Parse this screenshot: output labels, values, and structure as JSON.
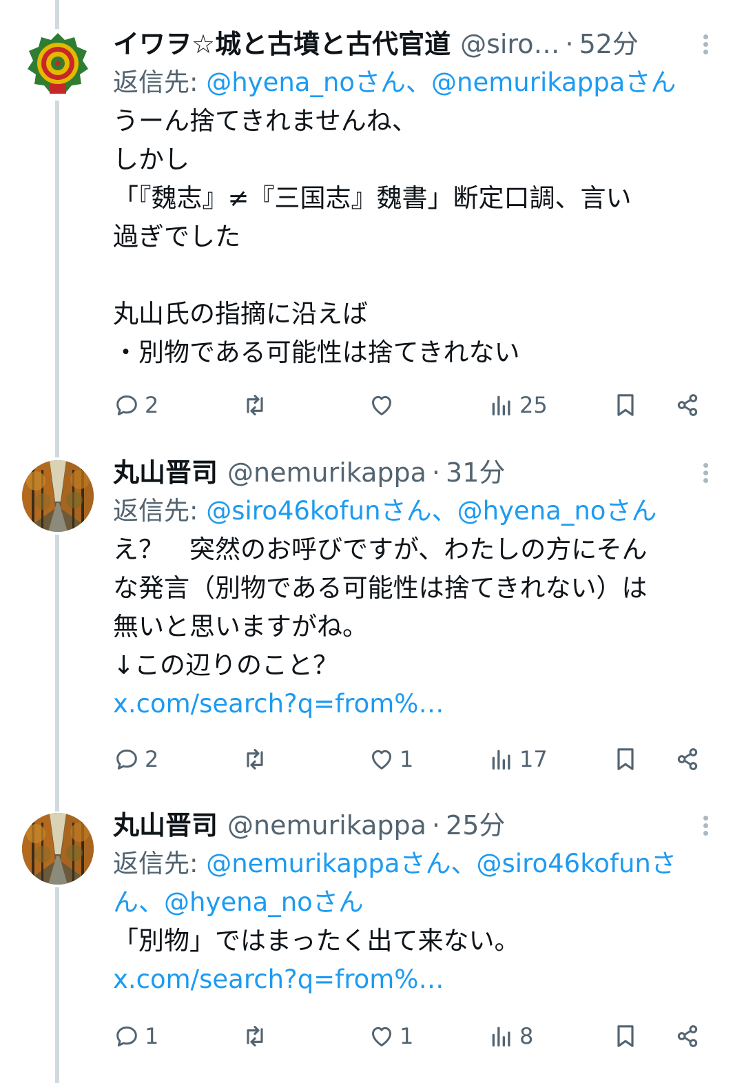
{
  "tweets": [
    {
      "name": "イワヲ☆城と古墳と古代官道",
      "handle": "@siro…",
      "separator": "·",
      "time": "52分",
      "reply_prefix": "返信先: ",
      "reply_to": "@hyena_noさん、@nemurikappaさん",
      "body": "うーん捨てきれませんね、\nしかし\n「『魏志』≠『三国志』魏書」断定口調、言い\n過ぎでした\n\n丸山氏の指摘に沿えば\n・別物である可能性は捨てきれない",
      "link": "",
      "replies": "2",
      "retweets": "",
      "likes": "",
      "views": "25"
    },
    {
      "name": "丸山晋司",
      "handle": "@nemurikappa",
      "separator": "·",
      "time": "31分",
      "reply_prefix": "返信先: ",
      "reply_to": "@siro46kofunさん、@hyena_noさん",
      "body": "え？　突然のお呼びですが、わたしの方にそん\nな発言（別物である可能性は捨てきれない）は\n無いと思いますがね。\n↓この辺りのこと？",
      "link": "x.com/search?q=from%…",
      "replies": "2",
      "retweets": "",
      "likes": "1",
      "views": "17"
    },
    {
      "name": "丸山晋司",
      "handle": "@nemurikappa",
      "separator": "·",
      "time": "25分",
      "reply_prefix": "返信先: ",
      "reply_to": "@nemurikappaさん、@siro46kofunさ\nん、@hyena_noさん",
      "body": "「別物」ではまったく出て来ない。",
      "link": "x.com/search?q=from%…",
      "replies": "1",
      "retweets": "",
      "likes": "1",
      "views": "8"
    }
  ],
  "colors": {
    "text": "#0f1419",
    "secondary": "#536471",
    "link": "#1d9bf0",
    "thread_line": "#cfd9de"
  },
  "icons": {
    "avatar1": "green-emblem-avatar",
    "avatar2": "tree-avenue-photo-avatar",
    "reply": "reply-icon",
    "retweet": "retweet-icon",
    "like": "heart-icon",
    "views": "views-chart-icon",
    "bookmark": "bookmark-icon",
    "share": "share-icon",
    "more": "more-vertical-icon"
  }
}
